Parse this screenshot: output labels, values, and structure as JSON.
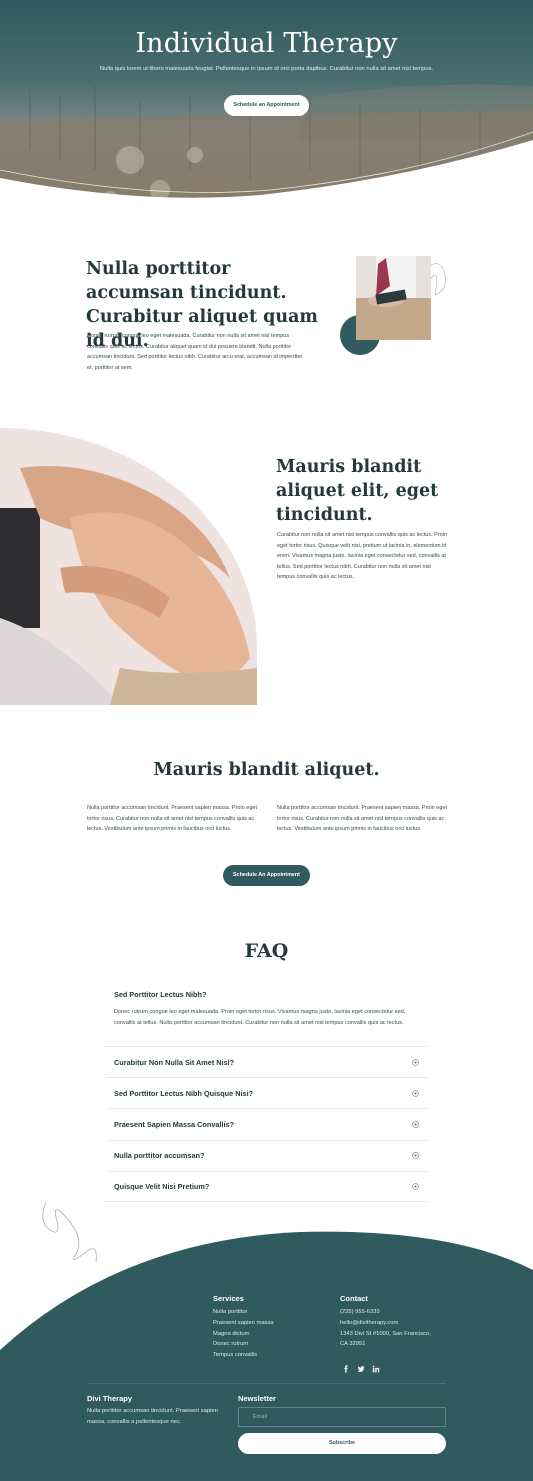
{
  "hero": {
    "title": "Individual Therapy",
    "subtitle": "Nulla quis lorem ut libero malesuada feugiat. Pellentesque in ipsum id orci porta dapibus. Curabitur non nulla sit amet nisl tempus.",
    "button_label": "Schedule an Appointment"
  },
  "section1": {
    "title": "Nulla porttitor accumsan tincidunt. Curabitur aliquet quam id dui.",
    "body": "Donec rutrum congue leo eget malesuada. Curabitur non nulla sit amet nisl tempus convallis quis ac lectus. Curabitur aliquet quam id dui posuere blandit. Nulla porttitor accumsan tincidunt. Sed porttitor lectus nibh. Curabitur arcu erat, accumsan id imperdiet et, porttitor at sem."
  },
  "section2": {
    "title": "Mauris blandit aliquet elit, eget tincidunt.",
    "body": "Curabitur non nulla sit amet nisl tempus convallis quis ac lectus. Proin eget tortor risus. Quisque velit nisi, pretium ut lacinia in, elementum id enim. Vivamus magna justo, lacinia eget consectetur sed, convallis at tellus. Sed porttitor lectus nibh. Curabitur non nulla sit amet nisl tempus convallis quis ac lectus."
  },
  "section3": {
    "title": "Mauris blandit aliquet.",
    "left_text": "Nulla porttitor accumsan tincidunt. Praesent sapien massa. Proin eget tortor risus. Curabitur non nulla sit amet nisl tempus convallis quis ac lectus. Vestibulum ante ipsum primis in faucibus orci luctus.",
    "right_text": "Nulla porttitor accumsan tincidunt. Praesent sapien massa. Proin eget tortor risus. Curabitur non nulla sit amet nisl tempus convallis quis ac lectus. Vestibulum ante ipsum primis in faucibus orci luctus.",
    "button_label": "Schedule An Appointment"
  },
  "faq": {
    "title": "FAQ",
    "open_question": "Sed Porttitor Lectus Nibh?",
    "open_answer": "Donec rutrum congue leo eget malesuada. Proin eget tortor risus. Vivamus magna justo, lacinia eget consectetur sed, convallis at tellus. Nulla porttitor accumsan tincidunt. Curabitur non nulla sit amet nisl tempus convallis quis ac lectus.",
    "items": [
      {
        "label": "Curabitur Non Nulla Sit Amet Nisl?"
      },
      {
        "label": "Sed Porttitor Lectus Nibh Quisque Nisi?"
      },
      {
        "label": "Praesent Sapien Massa Convallis?"
      },
      {
        "label": "Nulla porttitor accumsan?"
      },
      {
        "label": "Quisque Velit Nisi Pretium?"
      }
    ]
  },
  "footer": {
    "services_heading": "Services",
    "services": [
      "Nulla porttitor",
      "Praesent sapien massa",
      "Magna dictum",
      "Donec rutrum",
      "Tempus convallis"
    ],
    "contact_heading": "Contact",
    "phone": "(235) 955-6333",
    "email": "hello@divitherapy.com",
    "address_line1": "1343 Divi St #1000, San Francisco,",
    "address_line2": "CA 32951",
    "social_icons": [
      "facebook-icon",
      "twitter-icon",
      "linkedin-icon"
    ],
    "brand_heading": "Divi Therapy",
    "brand_text": "Nulla porttitor accumsan tincidunt. Praesent sapien massa, convallis a pellentesque nec.",
    "newsletter_heading": "Newsletter",
    "email_placeholder": "Email",
    "subscribe_label": "Subscribe"
  },
  "colors": {
    "primary": "#2f5a5e",
    "heading": "#24393c",
    "text": "#3c4b4d",
    "white": "#ffffff"
  }
}
